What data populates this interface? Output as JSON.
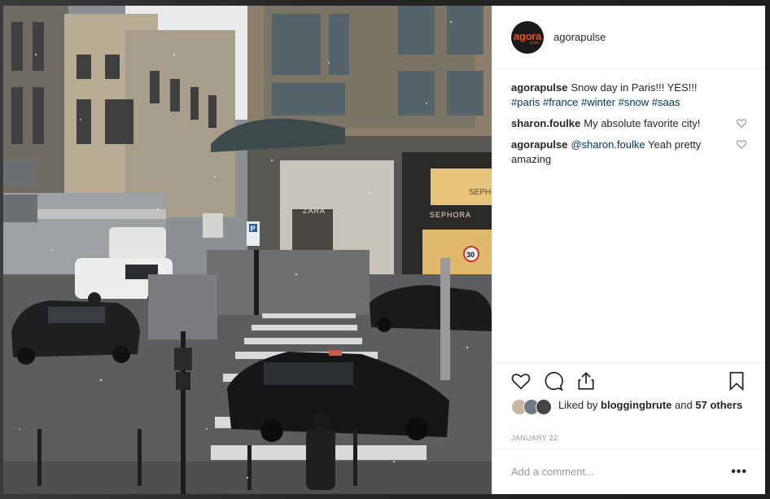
{
  "post": {
    "username": "agorapulse",
    "avatar": {
      "word": "agora",
      "sub": "pulse"
    },
    "photo": {
      "shop_signs": [
        "ZARA",
        "SEPHORA",
        "SEPH"
      ],
      "speed_sign": "30",
      "parking_sign": "P"
    },
    "comments": [
      {
        "user": "agorapulse",
        "text": "Snow day in Paris!!! YES!!!",
        "tags": [
          "#paris",
          "#france",
          "#winter",
          "#snow",
          "#saas"
        ],
        "likeable": false
      },
      {
        "user": "sharon.foulke",
        "text": "My absolute favorite city!",
        "tags": [],
        "likeable": true
      },
      {
        "user": "agorapulse",
        "mention": "@sharon.foulke",
        "text": "Yeah pretty amazing",
        "tags": [],
        "likeable": true
      }
    ],
    "likes": {
      "prefix": "Liked by",
      "first_user": "bloggingbrute",
      "joiner": "and",
      "others": "57 others"
    },
    "date": "JANUARY 22",
    "add_comment_placeholder": "Add a comment...",
    "more_label": "•••"
  },
  "icons": [
    "heart-icon",
    "comment-icon",
    "share-icon",
    "bookmark-icon",
    "more-icon"
  ],
  "colors": {
    "link": "#003569",
    "date": "#999999",
    "brand_orange": "#e8531f"
  }
}
